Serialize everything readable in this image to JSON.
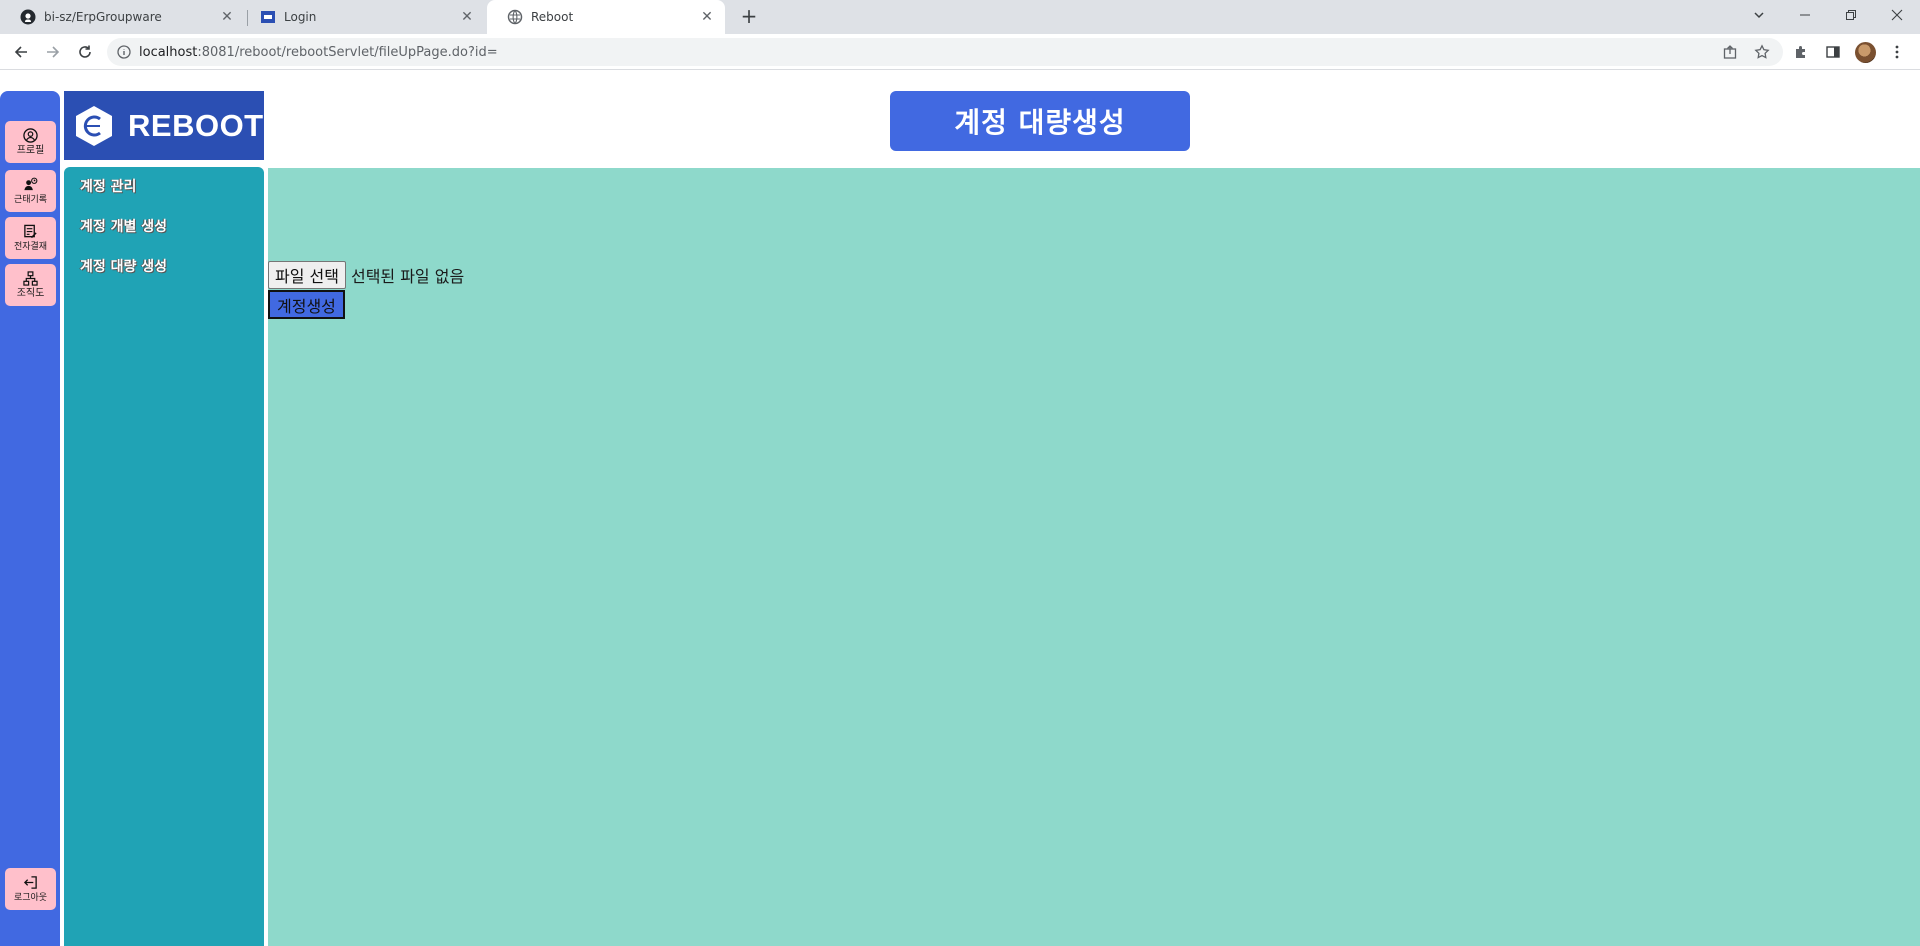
{
  "browser": {
    "tabs": [
      {
        "title": "bi-sz/ErpGroupware",
        "icon": "github-icon",
        "active": false
      },
      {
        "title": "Login",
        "icon": "site-favicon",
        "active": false
      },
      {
        "title": "Reboot",
        "icon": "globe-icon",
        "active": true
      }
    ],
    "url": {
      "host": "localhost",
      "rest": ":8081/reboot/rebootServlet/fileUpPage.do?id="
    }
  },
  "rail": {
    "items": [
      {
        "label": "프로필",
        "icon": "profile-icon"
      },
      {
        "label": "근태기록",
        "icon": "attendance-icon"
      },
      {
        "label": "전자결재",
        "icon": "approval-icon"
      },
      {
        "label": "조직도",
        "icon": "org-chart-icon"
      }
    ],
    "logout_label": "로그아웃"
  },
  "brand": {
    "name": "REBOOT"
  },
  "sidenav": {
    "items": [
      "계정 관리",
      "계정 개별 생성",
      "계정 대량 생성"
    ]
  },
  "header": {
    "title": "계정 대량생성"
  },
  "form": {
    "file_button_label": "파일 선택",
    "file_status": "선택된 파일 없음",
    "submit_label": "계정생성"
  },
  "colors": {
    "rail": "#4169e1",
    "rail_button": "#ffc0cb",
    "sidenav": "#20a3b5",
    "logo_bg": "#2b4fb3",
    "header_bg": "#4169e1",
    "content_bg": "#8ed9cb",
    "submit_bg": "#4169e1"
  }
}
